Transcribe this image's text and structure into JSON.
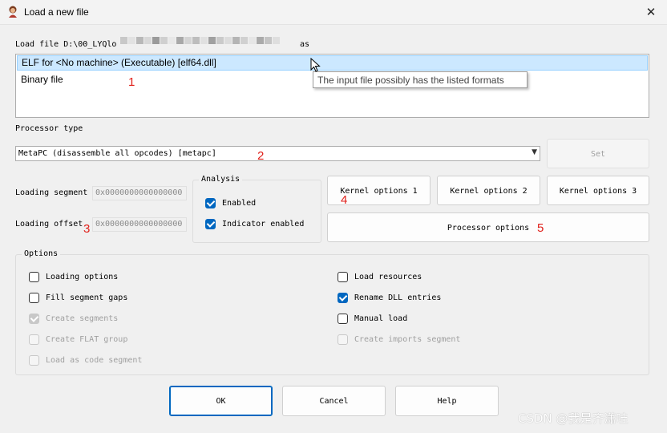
{
  "window": {
    "title": "Load a new file",
    "close_glyph": "✕",
    "icon": "ida-app-icon"
  },
  "load_file": {
    "label_prefix": "Load file D:\\00_LYQlo",
    "label_suffix": "as"
  },
  "formats": {
    "items": [
      {
        "label": "ELF for <No machine> (Executable) [elf64.dll]",
        "selected": true
      },
      {
        "label": "Binary file",
        "selected": false
      }
    ],
    "tooltip": "The input file possibly has the listed formats"
  },
  "processor": {
    "section_label": "Processor type",
    "selected": "MetaPC (disassemble all opcodes) [metapc]",
    "set_label": "Set"
  },
  "loading": {
    "segment_label": "Loading segment",
    "segment_value": "0x0000000000000000",
    "offset_label": "Loading offset",
    "offset_value": "0x0000000000000000"
  },
  "analysis": {
    "title": "Analysis",
    "enabled_label": "Enabled",
    "enabled_checked": true,
    "indicator_label": "Indicator enabled",
    "indicator_checked": true
  },
  "kernel_buttons": {
    "k1": "Kernel options 1",
    "k2": "Kernel options 2",
    "k3": "Kernel options 3",
    "processor_options": "Processor options"
  },
  "options": {
    "title": "Options",
    "left": [
      {
        "label": "Loading options",
        "checked": false,
        "disabled": false
      },
      {
        "label": "Fill segment gaps",
        "checked": false,
        "disabled": false
      },
      {
        "label": "Create segments",
        "checked": true,
        "disabled": true
      },
      {
        "label": "Create FLAT group",
        "checked": false,
        "disabled": true
      },
      {
        "label": "Load as code segment",
        "checked": false,
        "disabled": true
      }
    ],
    "right": [
      {
        "label": "Load resources",
        "checked": false,
        "disabled": false
      },
      {
        "label": "Rename DLL entries",
        "checked": true,
        "disabled": false
      },
      {
        "label": "Manual load",
        "checked": false,
        "disabled": false
      },
      {
        "label": "Create imports segment",
        "checked": false,
        "disabled": true
      }
    ]
  },
  "footer": {
    "ok": "OK",
    "cancel": "Cancel",
    "help": "Help"
  },
  "annotations": [
    "1",
    "2",
    "3",
    "4",
    "5"
  ],
  "watermark": "CSDN @我是齐潇哇",
  "colors": {
    "accent": "#0067c0",
    "selection": "#cce8ff",
    "annotation": "#e0201a"
  }
}
